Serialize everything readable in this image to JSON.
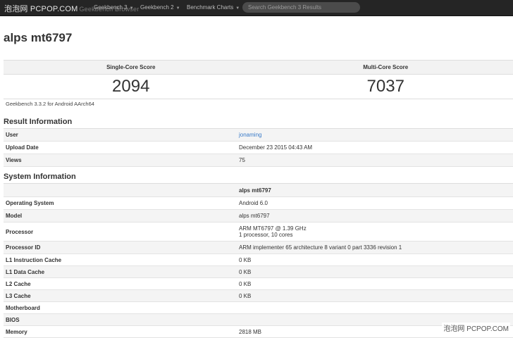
{
  "nav": {
    "brand": "泡泡网 PCPOP.COM",
    "brand_ghost": "Geekbench Browser",
    "items": [
      {
        "label": "Geekbench 3"
      },
      {
        "label": "Geekbench 2"
      },
      {
        "label": "Benchmark Charts"
      }
    ],
    "search_placeholder": "Search Geekbench 3 Results"
  },
  "page_title": "alps mt6797",
  "scores": {
    "single_label": "Single-Core Score",
    "multi_label": "Multi-Core Score",
    "single_value": "2094",
    "multi_value": "7037"
  },
  "version": "Geekbench 3.3.2 for Android AArch64",
  "result_info": {
    "title": "Result Information",
    "rows": [
      {
        "label": "User",
        "value": "jonaming"
      },
      {
        "label": "Upload Date",
        "value": "December 23 2015 04:43 AM"
      },
      {
        "label": "Views",
        "value": "75"
      }
    ]
  },
  "system_info": {
    "title": "System Information",
    "header_value": "alps mt6797",
    "rows": [
      {
        "label": "Operating System",
        "value": "Android 6.0"
      },
      {
        "label": "Model",
        "value": "alps mt6797"
      },
      {
        "label": "Processor",
        "value": "ARM MT6797 @ 1.39 GHz",
        "value2": "1 processor, 10 cores"
      },
      {
        "label": "Processor ID",
        "value": "ARM implementer 65 architecture 8 variant 0 part 3336 revision 1"
      },
      {
        "label": "L1 Instruction Cache",
        "value": "0 KB"
      },
      {
        "label": "L1 Data Cache",
        "value": "0 KB"
      },
      {
        "label": "L2 Cache",
        "value": "0 KB"
      },
      {
        "label": "L3 Cache",
        "value": "0 KB"
      },
      {
        "label": "Motherboard",
        "value": ""
      },
      {
        "label": "BIOS",
        "value": ""
      },
      {
        "label": "Memory",
        "value": "2818 MB"
      }
    ]
  },
  "watermark": "泡泡网 PCPOP.COM"
}
